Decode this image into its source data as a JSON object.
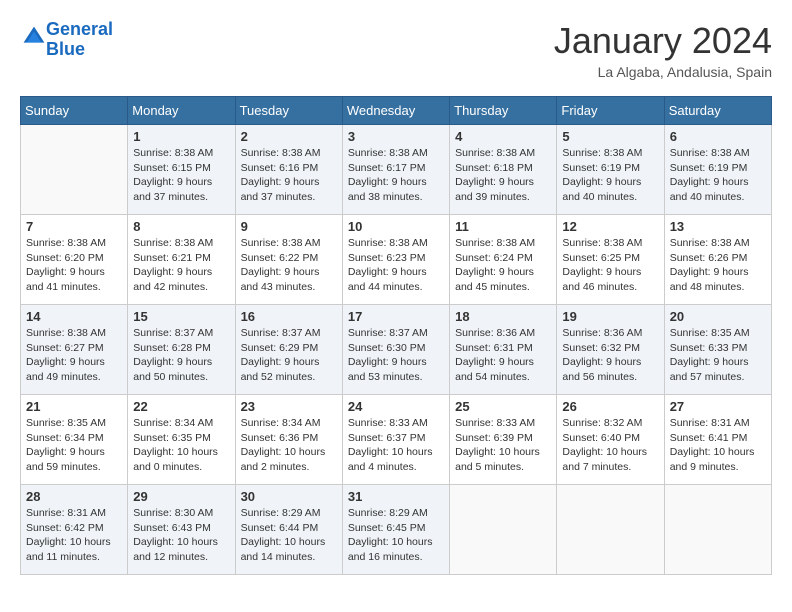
{
  "logo": {
    "line1": "General",
    "line2": "Blue"
  },
  "header": {
    "month": "January 2024",
    "location": "La Algaba, Andalusia, Spain"
  },
  "weekdays": [
    "Sunday",
    "Monday",
    "Tuesday",
    "Wednesday",
    "Thursday",
    "Friday",
    "Saturday"
  ],
  "weeks": [
    [
      {
        "day": "",
        "info": ""
      },
      {
        "day": "1",
        "info": "Sunrise: 8:38 AM\nSunset: 6:15 PM\nDaylight: 9 hours\nand 37 minutes."
      },
      {
        "day": "2",
        "info": "Sunrise: 8:38 AM\nSunset: 6:16 PM\nDaylight: 9 hours\nand 37 minutes."
      },
      {
        "day": "3",
        "info": "Sunrise: 8:38 AM\nSunset: 6:17 PM\nDaylight: 9 hours\nand 38 minutes."
      },
      {
        "day": "4",
        "info": "Sunrise: 8:38 AM\nSunset: 6:18 PM\nDaylight: 9 hours\nand 39 minutes."
      },
      {
        "day": "5",
        "info": "Sunrise: 8:38 AM\nSunset: 6:19 PM\nDaylight: 9 hours\nand 40 minutes."
      },
      {
        "day": "6",
        "info": "Sunrise: 8:38 AM\nSunset: 6:19 PM\nDaylight: 9 hours\nand 40 minutes."
      }
    ],
    [
      {
        "day": "7",
        "info": "Sunrise: 8:38 AM\nSunset: 6:20 PM\nDaylight: 9 hours\nand 41 minutes."
      },
      {
        "day": "8",
        "info": "Sunrise: 8:38 AM\nSunset: 6:21 PM\nDaylight: 9 hours\nand 42 minutes."
      },
      {
        "day": "9",
        "info": "Sunrise: 8:38 AM\nSunset: 6:22 PM\nDaylight: 9 hours\nand 43 minutes."
      },
      {
        "day": "10",
        "info": "Sunrise: 8:38 AM\nSunset: 6:23 PM\nDaylight: 9 hours\nand 44 minutes."
      },
      {
        "day": "11",
        "info": "Sunrise: 8:38 AM\nSunset: 6:24 PM\nDaylight: 9 hours\nand 45 minutes."
      },
      {
        "day": "12",
        "info": "Sunrise: 8:38 AM\nSunset: 6:25 PM\nDaylight: 9 hours\nand 46 minutes."
      },
      {
        "day": "13",
        "info": "Sunrise: 8:38 AM\nSunset: 6:26 PM\nDaylight: 9 hours\nand 48 minutes."
      }
    ],
    [
      {
        "day": "14",
        "info": "Sunrise: 8:38 AM\nSunset: 6:27 PM\nDaylight: 9 hours\nand 49 minutes."
      },
      {
        "day": "15",
        "info": "Sunrise: 8:37 AM\nSunset: 6:28 PM\nDaylight: 9 hours\nand 50 minutes."
      },
      {
        "day": "16",
        "info": "Sunrise: 8:37 AM\nSunset: 6:29 PM\nDaylight: 9 hours\nand 52 minutes."
      },
      {
        "day": "17",
        "info": "Sunrise: 8:37 AM\nSunset: 6:30 PM\nDaylight: 9 hours\nand 53 minutes."
      },
      {
        "day": "18",
        "info": "Sunrise: 8:36 AM\nSunset: 6:31 PM\nDaylight: 9 hours\nand 54 minutes."
      },
      {
        "day": "19",
        "info": "Sunrise: 8:36 AM\nSunset: 6:32 PM\nDaylight: 9 hours\nand 56 minutes."
      },
      {
        "day": "20",
        "info": "Sunrise: 8:35 AM\nSunset: 6:33 PM\nDaylight: 9 hours\nand 57 minutes."
      }
    ],
    [
      {
        "day": "21",
        "info": "Sunrise: 8:35 AM\nSunset: 6:34 PM\nDaylight: 9 hours\nand 59 minutes."
      },
      {
        "day": "22",
        "info": "Sunrise: 8:34 AM\nSunset: 6:35 PM\nDaylight: 10 hours\nand 0 minutes."
      },
      {
        "day": "23",
        "info": "Sunrise: 8:34 AM\nSunset: 6:36 PM\nDaylight: 10 hours\nand 2 minutes."
      },
      {
        "day": "24",
        "info": "Sunrise: 8:33 AM\nSunset: 6:37 PM\nDaylight: 10 hours\nand 4 minutes."
      },
      {
        "day": "25",
        "info": "Sunrise: 8:33 AM\nSunset: 6:39 PM\nDaylight: 10 hours\nand 5 minutes."
      },
      {
        "day": "26",
        "info": "Sunrise: 8:32 AM\nSunset: 6:40 PM\nDaylight: 10 hours\nand 7 minutes."
      },
      {
        "day": "27",
        "info": "Sunrise: 8:31 AM\nSunset: 6:41 PM\nDaylight: 10 hours\nand 9 minutes."
      }
    ],
    [
      {
        "day": "28",
        "info": "Sunrise: 8:31 AM\nSunset: 6:42 PM\nDaylight: 10 hours\nand 11 minutes."
      },
      {
        "day": "29",
        "info": "Sunrise: 8:30 AM\nSunset: 6:43 PM\nDaylight: 10 hours\nand 12 minutes."
      },
      {
        "day": "30",
        "info": "Sunrise: 8:29 AM\nSunset: 6:44 PM\nDaylight: 10 hours\nand 14 minutes."
      },
      {
        "day": "31",
        "info": "Sunrise: 8:29 AM\nSunset: 6:45 PM\nDaylight: 10 hours\nand 16 minutes."
      },
      {
        "day": "",
        "info": ""
      },
      {
        "day": "",
        "info": ""
      },
      {
        "day": "",
        "info": ""
      }
    ]
  ]
}
